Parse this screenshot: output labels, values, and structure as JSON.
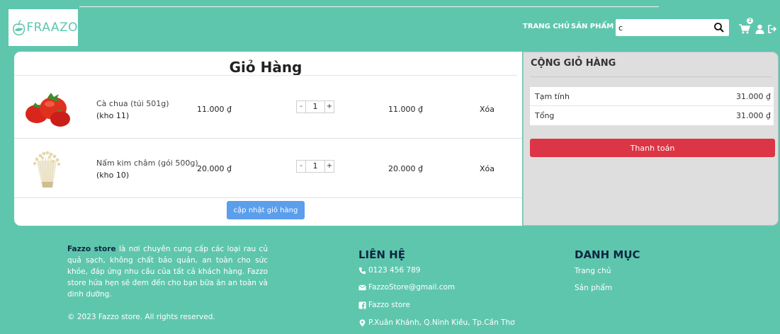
{
  "header": {
    "logo_text": "FRAAZO",
    "nav_home": "TRANG CHỦ",
    "nav_products": "SẢN PHẨM",
    "search_value": "c",
    "cart_count": "2"
  },
  "cart": {
    "title": "Giỏ Hàng",
    "items": [
      {
        "name": "Cà chua (túi 501g)",
        "stock": "(kho 11)",
        "price": "11.000 ₫",
        "quantity": "1",
        "subtotal": "11.000 ₫",
        "remove_label": "Xóa"
      },
      {
        "name": "Nấm kim châm (gói 500g)",
        "stock": "(kho 10)",
        "price": "20.000 ₫",
        "quantity": "1",
        "subtotal": "20.000 ₫",
        "remove_label": "Xóa"
      }
    ],
    "minus_label": "-",
    "plus_label": "+",
    "update_label": "cập nhật giỏ hàng"
  },
  "totals": {
    "title": "CỘNG GIỎ HÀNG",
    "subtotal_label": "Tạm tính",
    "subtotal_value": "31.000 ₫",
    "total_label": "Tổng",
    "total_value": "31.000 ₫",
    "checkout_label": "Thanh toán"
  },
  "footer": {
    "brand": "Fazzo store",
    "about": " là nơi chuyên cung cấp các loại rau củ quả sạch, không chất bảo quản, an toàn cho sức khỏe, đáp ứng nhu cầu của tất cả khách hàng. Fazzo store hứa hẹn sẽ đem đến cho bạn bữa ăn an toàn và dinh dưỡng.",
    "copyright": "© 2023 Fazzo store. All rights reserved.",
    "contact_title": "LIÊN HỆ",
    "phone": "0123 456 789",
    "email": "FazzoStore@gmail.com",
    "facebook": "Fazzo store",
    "address": "P.Xuân Khánh, Q.Ninh Kiều, Tp.Cần Thơ",
    "category_title": "DANH MỤC",
    "category_home": "Trang chủ",
    "category_products": "Sản phẩm"
  },
  "colors": {
    "brand_green": "#5fc6ae",
    "checkout_red": "#dc3545",
    "update_blue": "#5b9eec",
    "heading_navy": "#0d2740"
  }
}
